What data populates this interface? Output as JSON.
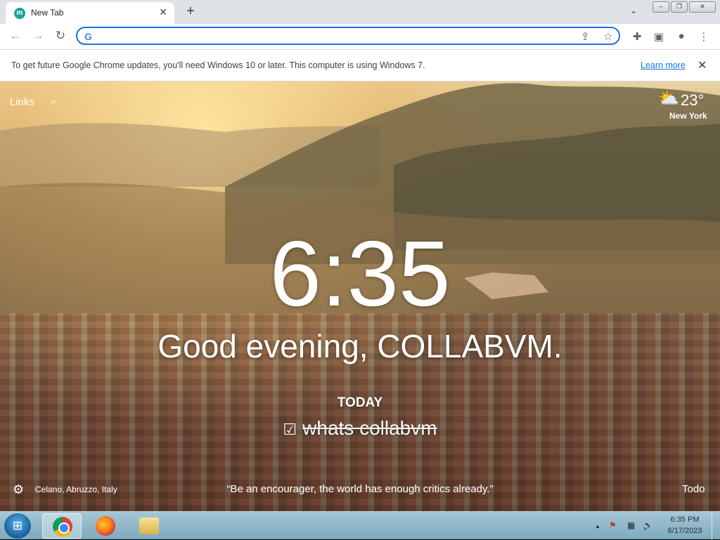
{
  "tab": {
    "favicon_letter": "m",
    "title": "New Tab",
    "close": "✕"
  },
  "new_tab": "+",
  "tab_search": "⌄",
  "window_controls": {
    "minimize": "–",
    "maximize": "❐",
    "close": "✕"
  },
  "toolbar": {
    "back": "←",
    "forward": "→",
    "reload": "↻",
    "address_value": "",
    "g_logo": "G",
    "share": "⇪",
    "bookmark": "☆",
    "extensions": "✚",
    "side_panel": "▣",
    "profile": "●",
    "menu": "⋮"
  },
  "infobar": {
    "message": "To get future Google Chrome updates, you'll need Windows 10 or later. This computer is using Windows 7.",
    "link": "Learn more",
    "close": "✕"
  },
  "momentum": {
    "links": "Links",
    "search": "⌕",
    "weather_icon": "⛅",
    "temperature": "23°",
    "city": "New York",
    "time": "6:35",
    "greeting": "Good evening, COLLABVM.",
    "today_label": "TODAY",
    "focus_check": "☑",
    "focus_text": "whats collabvm",
    "settings": "⚙",
    "photo_location": "Celano, Abruzzo, Italy",
    "quote": "“Be an encourager, the world has enough critics already.”",
    "todo": "Todo"
  },
  "taskbar": {
    "start": "⊞",
    "apps": [
      {
        "name": "Google Chrome",
        "active": true
      },
      {
        "name": "Firefox",
        "active": false
      },
      {
        "name": "File Explorer",
        "active": false
      }
    ],
    "tray": {
      "chevron": "▲",
      "flag": "⚑",
      "network": "▦",
      "volume": "🔊"
    },
    "time": "6:35 PM",
    "date": "6/17/2023"
  },
  "colors": {
    "accent": "#1a73e8",
    "tab_strip": "#dee1e6",
    "favicon": "#1aa39a"
  }
}
